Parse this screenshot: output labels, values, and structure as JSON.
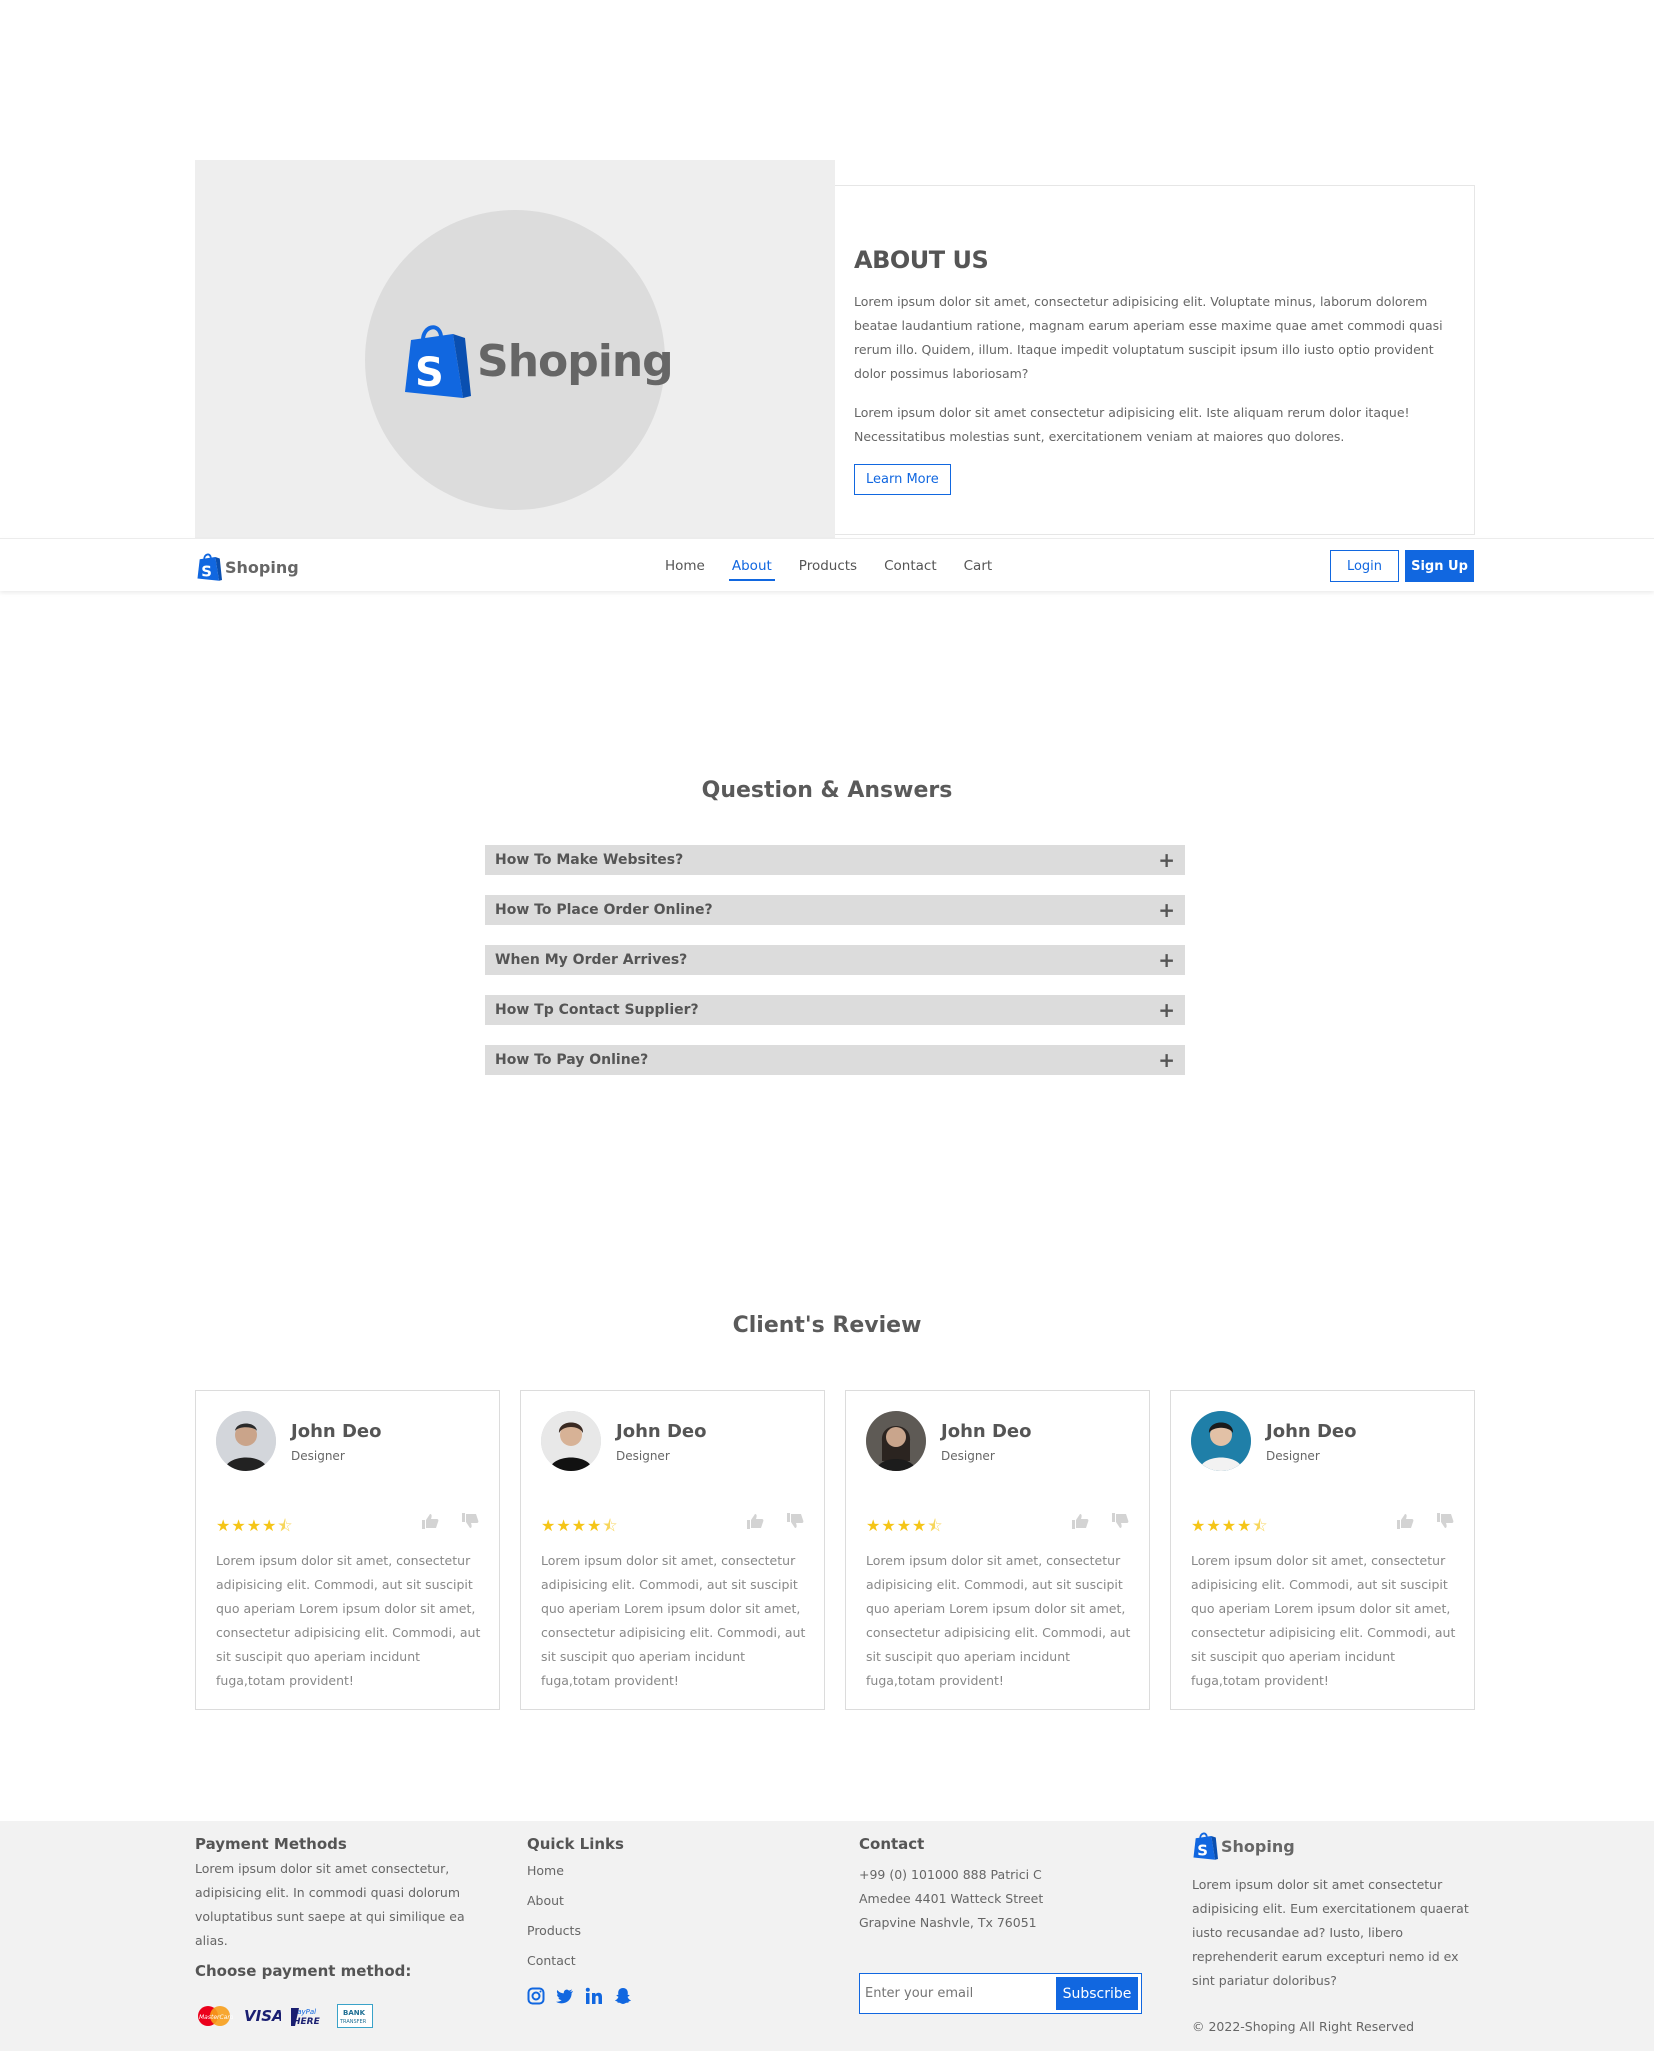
{
  "brand": {
    "name": "Shoping",
    "color": "#1167e0"
  },
  "about": {
    "heading": "ABOUT US",
    "para1": "Lorem ipsum dolor sit amet, consectetur adipisicing elit. Voluptate minus, laborum dolorem beatae laudantium ratione, magnam earum aperiam esse maxime quae amet commodi quasi rerum illo. Quidem, illum. Itaque impedit voluptatum suscipit ipsum illo iusto optio provident dolor possimus laboriosam?",
    "para2": "Lorem ipsum dolor sit amet consectetur adipisicing elit. Iste aliquam rerum dolor itaque! Necessitatibus molestias sunt, exercitationem veniam at maiores quo dolores.",
    "button": "Learn More"
  },
  "nav": {
    "links": [
      "Home",
      "About",
      "Products",
      "Contact",
      "Cart"
    ],
    "active": "About",
    "login": "Login",
    "signup": "Sign Up"
  },
  "qa": {
    "title": "Question & Answers",
    "items": [
      "How To Make Websites?",
      "How To Place Order Online?",
      "When My Order Arrives?",
      "How Tp Contact Supplier?",
      "How To Pay Online?"
    ]
  },
  "reviews": {
    "title": "Client's Review",
    "cards": [
      {
        "name": "John Deo",
        "role": "Designer",
        "rating": 4.5,
        "text": "Lorem ipsum dolor sit amet, consectetur adipisicing elit. Commodi, aut sit suscipit quo aperiam Lorem ipsum dolor sit amet, consectetur adipisicing elit. Commodi, aut sit suscipit quo aperiam incidunt fuga,totam provident!"
      },
      {
        "name": "John Deo",
        "role": "Designer",
        "rating": 4.5,
        "text": "Lorem ipsum dolor sit amet, consectetur adipisicing elit. Commodi, aut sit suscipit quo aperiam Lorem ipsum dolor sit amet, consectetur adipisicing elit. Commodi, aut sit suscipit quo aperiam incidunt fuga,totam provident!"
      },
      {
        "name": "John Deo",
        "role": "Designer",
        "rating": 4.5,
        "text": "Lorem ipsum dolor sit amet, consectetur adipisicing elit. Commodi, aut sit suscipit quo aperiam Lorem ipsum dolor sit amet, consectetur adipisicing elit. Commodi, aut sit suscipit quo aperiam incidunt fuga,totam provident!"
      },
      {
        "name": "John Deo",
        "role": "Designer",
        "rating": 4.5,
        "text": "Lorem ipsum dolor sit amet, consectetur adipisicing elit. Commodi, aut sit suscipit quo aperiam Lorem ipsum dolor sit amet, consectetur adipisicing elit. Commodi, aut sit suscipit quo aperiam incidunt fuga,totam provident!"
      }
    ]
  },
  "footer": {
    "payment": {
      "title": "Payment Methods",
      "text": "Lorem ipsum dolor sit amet consectetur, adipisicing elit. In commodi quasi dolorum voluptatibus sunt saepe at qui similique ea alias.",
      "choose": "Choose payment method:",
      "methods": [
        "MasterCard",
        "VISA",
        "PayPal HERE",
        "BANK TRANSFER"
      ]
    },
    "links": {
      "title": "Quick Links",
      "items": [
        "Home",
        "About",
        "Products",
        "Contact"
      ],
      "socials": [
        "instagram-icon",
        "twitter-icon",
        "linkedin-icon",
        "snapchat-icon"
      ]
    },
    "contact": {
      "title": "Contact",
      "line1": "+99 (0) 101000 888 Patrici C",
      "line2": "Amedee 4401 Watteck Street",
      "line3": "Grapvine Nashvle, Tx 76051",
      "placeholder": "Enter your email",
      "button": "Subscribe"
    },
    "brand": {
      "name": "Shoping",
      "text": "Lorem ipsum dolor sit amet consectetur adipisicing elit. Eum exercitationem quaerat iusto recusandae ad? Iusto, libero reprehenderit earum excepturi nemo id ex sint pariatur doloribus?",
      "copyright": "© 2022-Shoping All Right Reserved"
    }
  }
}
